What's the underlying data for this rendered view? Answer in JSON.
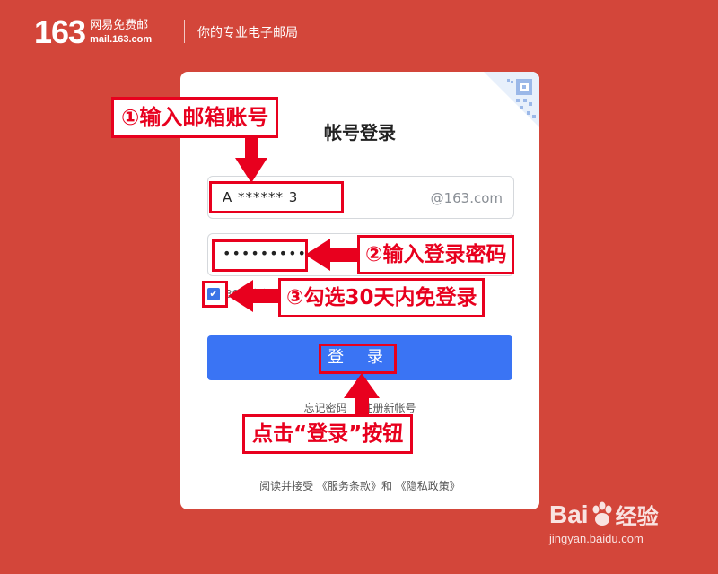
{
  "header": {
    "logo_number": "163",
    "logo_cn": "网易免费邮",
    "logo_domain": "mail.163.com",
    "slogan": "你的专业电子邮局"
  },
  "login": {
    "title": "帐号登录",
    "username_value": "A ****** 3",
    "username_suffix": "@163.com",
    "password_mask": "••••••••••••",
    "remember_label": "30天内免登录",
    "remember_checked": true,
    "submit_label": "登 录",
    "forgot_link": "忘记密码",
    "register_link": "注册新帐号",
    "terms_text": "阅读并接受 《服务条款》和 《隐私政策》"
  },
  "annotations": {
    "step1": "①输入邮箱账号",
    "step2": "②输入登录密码",
    "step3": "③勾选30天内免登录",
    "step4": "点击“登录”按钮"
  },
  "watermark": {
    "brand": "Bai",
    "brand_tail": "经验",
    "url": "jingyan.baidu.com"
  },
  "colors": {
    "background": "#d3463a",
    "button": "#3a74f4",
    "annotation": "#e8001e"
  }
}
